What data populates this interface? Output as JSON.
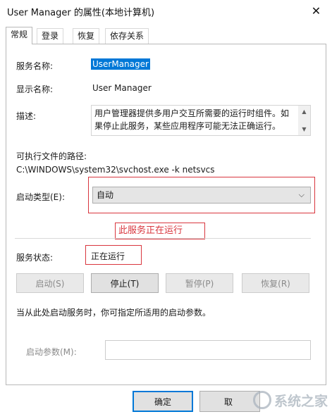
{
  "window": {
    "title": "User Manager 的属性(本地计算机)",
    "close_glyph": "✕"
  },
  "tabs": [
    {
      "label": "常规",
      "active": true
    },
    {
      "label": "登录",
      "active": false
    },
    {
      "label": "恢复",
      "active": false
    },
    {
      "label": "依存关系",
      "active": false
    }
  ],
  "general": {
    "service_name_label": "服务名称:",
    "service_name": "UserManager",
    "display_name_label": "显示名称:",
    "display_name": "User Manager",
    "description_label": "描述:",
    "description": "用户管理器提供多用户交互所需要的运行时组件。如果停止此服务，某些应用程序可能无法正确运行。",
    "exe_path_label": "可执行文件的路径:",
    "exe_path": "C:\\WINDOWS\\system32\\svchost.exe -k netsvcs",
    "startup_type_label": "启动类型(E):",
    "startup_type": "自动",
    "annotation": "此服务正在运行",
    "status_label": "服务状态:",
    "status": "正在运行",
    "buttons": {
      "start": "启动(S)",
      "stop": "停止(T)",
      "pause": "暂停(P)",
      "resume": "恢复(R)"
    },
    "hint": "当从此处启动服务时，你可指定所适用的启动参数。",
    "start_params_label": "启动参数(M):",
    "start_params_value": ""
  },
  "footer": {
    "ok": "确定",
    "cancel_partial": "取"
  },
  "icons": {
    "close": "close-icon",
    "dropdown": "chevron-down-icon",
    "scroll_up": "chevron-up-icon",
    "scroll_down": "chevron-down-icon"
  },
  "colors": {
    "selection": "#0078d7",
    "annotation_red": "#d9363e",
    "disabled_text": "#8a8a8a"
  },
  "watermark": {
    "text": "系统之家"
  }
}
